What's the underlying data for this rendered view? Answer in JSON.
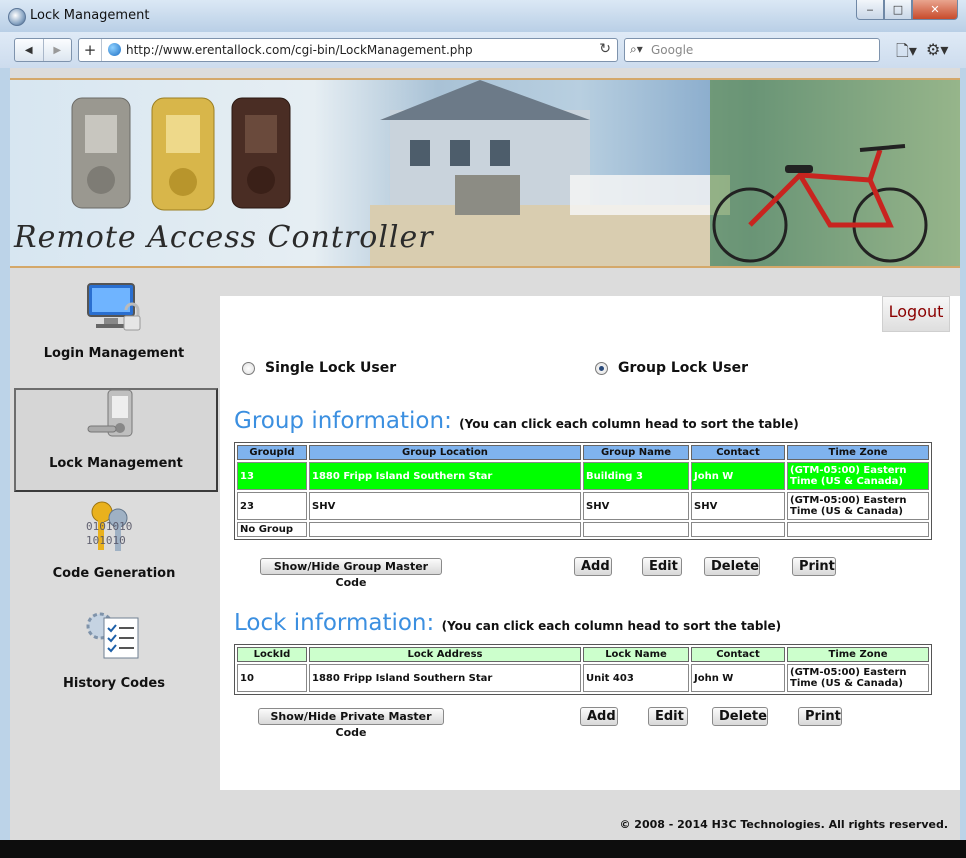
{
  "window": {
    "title": "Lock Management"
  },
  "browser": {
    "url": "http://www.erentallock.com/cgi-bin/LockManagement.php",
    "search_placeholder": "Google"
  },
  "banner": {
    "title": "Remote Access Controller"
  },
  "sidebar": {
    "items": [
      {
        "label": "Login Management",
        "icon": "computer-lock-icon"
      },
      {
        "label": "Lock Management",
        "icon": "keypad-lock-icon"
      },
      {
        "label": "Code Generation",
        "icon": "keys-binary-icon"
      },
      {
        "label": "History Codes",
        "icon": "checklist-gear-icon"
      }
    ],
    "binary_text": "0101010\n101010"
  },
  "header": {
    "logout_label": "Logout"
  },
  "user_type": {
    "single_label": "Single Lock User",
    "group_label": "Group Lock User",
    "selected": "group"
  },
  "group_info": {
    "title": "Group information:",
    "subtitle": "(You can click each column head to sort the table)",
    "columns": [
      "GroupId",
      "Group Location",
      "Group Name",
      "Contact",
      "Time Zone"
    ],
    "rows": [
      [
        "13",
        "1880 Fripp Island Southern Star",
        "Building 3",
        "John W",
        "(GTM-05:00) Eastern Time (US & Canada)"
      ],
      [
        "23",
        "SHV",
        "SHV",
        "SHV",
        "(GTM-05:00) Eastern Time (US & Canada)"
      ],
      [
        "No Group",
        "",
        "",
        "",
        ""
      ]
    ],
    "buttons": {
      "master": "Show/Hide Group Master Code",
      "add": "Add",
      "edit": "Edit",
      "delete": "Delete",
      "print": "Print"
    }
  },
  "lock_info": {
    "title": "Lock information:",
    "subtitle": "(You can click each column head to sort the table)",
    "columns": [
      "LockId",
      "Lock Address",
      "Lock Name",
      "Contact",
      "Time Zone"
    ],
    "rows": [
      [
        "10",
        "1880 Fripp Island Southern Star",
        "Unit 403",
        "John W",
        "(GTM-05:00) Eastern Time (US & Canada)"
      ]
    ],
    "buttons": {
      "master": "Show/Hide Private Master Code",
      "add": "Add",
      "edit": "Edit",
      "delete": "Delete",
      "print": "Print"
    }
  },
  "footer": {
    "copyright": "© 2008 - 2014 H3C Technologies. All rights reserved."
  },
  "colors": {
    "accent_blue": "#3b8fe0",
    "selected_row": "#00ff00",
    "group_header": "#7fb3ee",
    "lock_header": "#ccffcc",
    "logout_text": "#8b0000"
  }
}
